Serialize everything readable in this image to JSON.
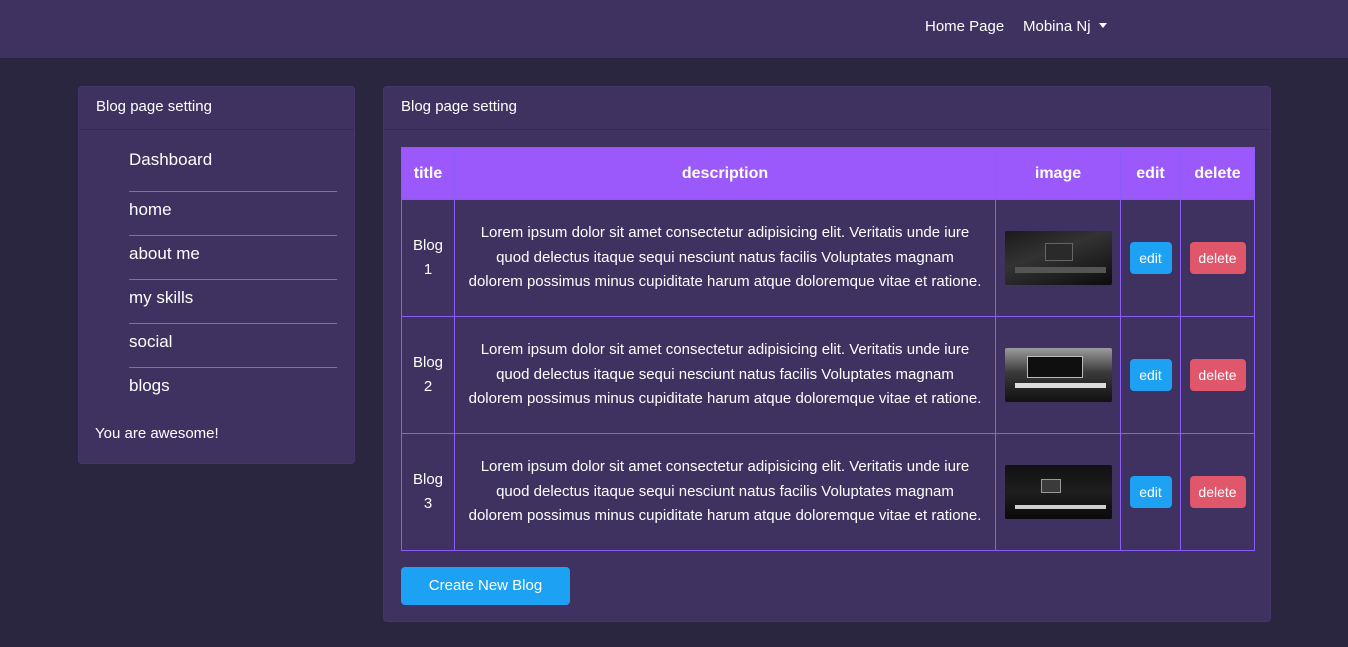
{
  "navbar": {
    "home_label": "Home Page",
    "user_label": "Mobina Nj"
  },
  "sidebar": {
    "header": "Blog page setting",
    "items": [
      {
        "label": "Dashboard"
      },
      {
        "label": "home"
      },
      {
        "label": "about me"
      },
      {
        "label": "my skills"
      },
      {
        "label": "social"
      },
      {
        "label": "blogs"
      }
    ],
    "footer": "You are awesome!"
  },
  "main": {
    "header": "Blog page setting",
    "columns": [
      "title",
      "description",
      "image",
      "edit",
      "delete"
    ],
    "rows": [
      {
        "title": "Blog 1",
        "description": "Lorem ipsum dolor sit amet consectetur adipisicing elit. Veritatis unde iure quod delectus itaque sequi nesciunt natus facilis Voluptates magnam dolorem possimus minus cupiditate harum atque doloremque vitae et ratione.",
        "edit_label": "edit",
        "delete_label": "delete"
      },
      {
        "title": "Blog 2",
        "description": "Lorem ipsum dolor sit amet consectetur adipisicing elit. Veritatis unde iure quod delectus itaque sequi nesciunt natus facilis Voluptates magnam dolorem possimus minus cupiditate harum atque doloremque vitae et ratione.",
        "edit_label": "edit",
        "delete_label": "delete"
      },
      {
        "title": "Blog 3",
        "description": "Lorem ipsum dolor sit amet consectetur adipisicing elit. Veritatis unde iure quod delectus itaque sequi nesciunt natus facilis Voluptates magnam dolorem possimus minus cupiditate harum atque doloremque vitae et ratione.",
        "edit_label": "edit",
        "delete_label": "delete"
      }
    ],
    "create_label": "Create New Blog"
  },
  "colors": {
    "background": "#2b2640",
    "panel": "#3f3160",
    "table_header": "#9b59fc",
    "border": "#8b5cf6",
    "edit_button": "#1da1f2",
    "delete_button": "#e0566b"
  }
}
